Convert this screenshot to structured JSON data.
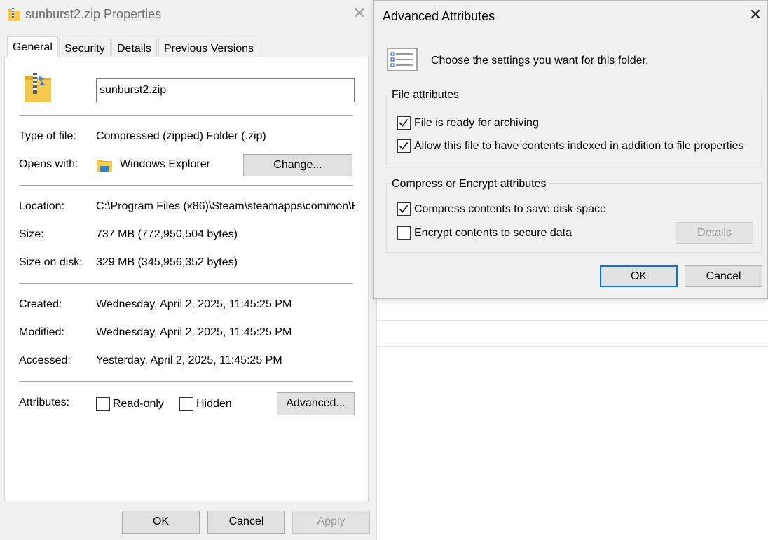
{
  "props_window": {
    "title": "sunburst2.zip Properties",
    "close_glyph": "✕",
    "tabs": [
      "General",
      "Security",
      "Details",
      "Previous Versions"
    ],
    "active_tab": "General",
    "file_icon": "zip-folder-icon",
    "file_name": "sunburst2.zip",
    "type_label": "Type of file:",
    "type_value": "Compressed (zipped) Folder (.zip)",
    "opens_label": "Opens with:",
    "opens_value": "Windows Explorer",
    "opens_icon": "windows-explorer-icon",
    "change_label": "Change...",
    "location_label": "Location:",
    "location_value": "C:\\Program Files (x86)\\Steam\\steamapps\\common\\B",
    "size_label": "Size:",
    "size_value": "737 MB (772,950,504 bytes)",
    "size_disk_label": "Size on disk:",
    "size_disk_value": "329 MB (345,956,352 bytes)",
    "created_label": "Created:",
    "created_value": "Wednesday, April 2, 2025, 11:45:25 PM",
    "modified_label": "Modified:",
    "modified_value": "Wednesday, April 2, 2025, 11:45:25 PM",
    "accessed_label": "Accessed:",
    "accessed_value": "Yesterday, April 2, 2025, 11:45:25 PM",
    "attributes_label": "Attributes:",
    "readonly_label": "Read-only",
    "readonly_checked": false,
    "hidden_label": "Hidden",
    "hidden_checked": false,
    "advanced_label": "Advanced...",
    "ok_label": "OK",
    "cancel_label": "Cancel",
    "apply_label": "Apply"
  },
  "adv_dialog": {
    "title": "Advanced Attributes",
    "close_glyph": "✕",
    "header_icon": "settings-list-icon",
    "description": "Choose the settings you want for this folder.",
    "file_attr_group": "File attributes",
    "archive_label": "File is ready for archiving",
    "archive_checked": true,
    "index_label": "Allow this file to have contents indexed in addition to file properties",
    "index_checked": true,
    "compress_group": "Compress or Encrypt attributes",
    "compress_label": "Compress contents to save disk space",
    "compress_checked": true,
    "encrypt_label": "Encrypt contents to secure data",
    "encrypt_checked": false,
    "details_label": "Details",
    "ok_label": "OK",
    "cancel_label": "Cancel"
  },
  "colors": {
    "accent": "#0078d7",
    "dialog_bg": "#f0f0f0",
    "folder_yellow": "#f4c94e"
  }
}
